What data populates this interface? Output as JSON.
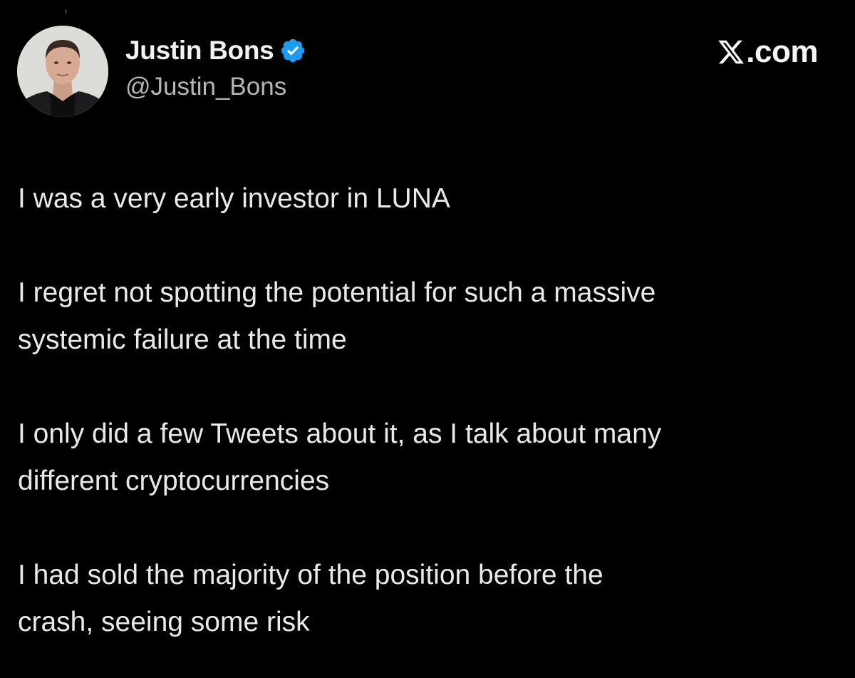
{
  "author": {
    "name": "Justin Bons",
    "handle": "@Justin_Bons",
    "verified": true,
    "verified_color": "#1d9bf0"
  },
  "brand": {
    "suffix": ".com",
    "logo_icon": "x-logo-icon"
  },
  "tweet": {
    "paragraphs": [
      "I was a very early investor in LUNA",
      "I regret not spotting the potential for such a massive\nsystemic failure at the time",
      "I only did a few Tweets about it, as I talk about many\ndifferent cryptocurrencies",
      "I had sold the majority of the position before the\ncrash, seeing some risk"
    ]
  },
  "colors": {
    "background": "#000000",
    "text": "#e9e9e9",
    "handle": "#b4b7ba"
  }
}
